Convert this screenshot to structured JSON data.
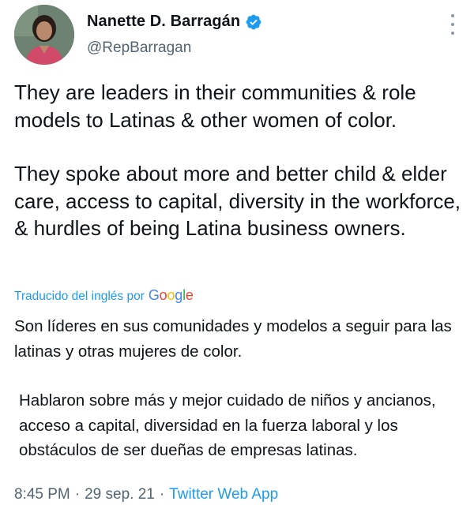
{
  "author": {
    "name": "Nanette D. Barragán",
    "handle": "@RepBarragan",
    "verified": true
  },
  "tweet": {
    "paragraphs": [
      "They are leaders in their communities & role models to Latinas & other women of color.",
      "They spoke about more and better child & elder care, access to capital, diversity in the workforce, & hurdles of being Latina business owners."
    ]
  },
  "translation": {
    "label": "Traducido del inglés por",
    "provider": "Google",
    "paragraphs": [
      "Son líderes en sus comunidades y modelos a seguir para las latinas y otras mujeres de color.",
      "Hablaron sobre más y mejor cuidado de niños y ancianos, acceso a capital, diversidad en la fuerza laboral y los obstáculos de ser dueñas de empresas latinas."
    ]
  },
  "meta": {
    "time": "8:45 PM",
    "separator": "·",
    "date": "29 sep. 21",
    "source": "Twitter Web App"
  },
  "icons": {
    "verified": "verified-badge-icon",
    "more": "more-options-icon"
  },
  "colors": {
    "accent": "#1d9bf0",
    "text": "#0f1419",
    "secondary": "#536471"
  }
}
